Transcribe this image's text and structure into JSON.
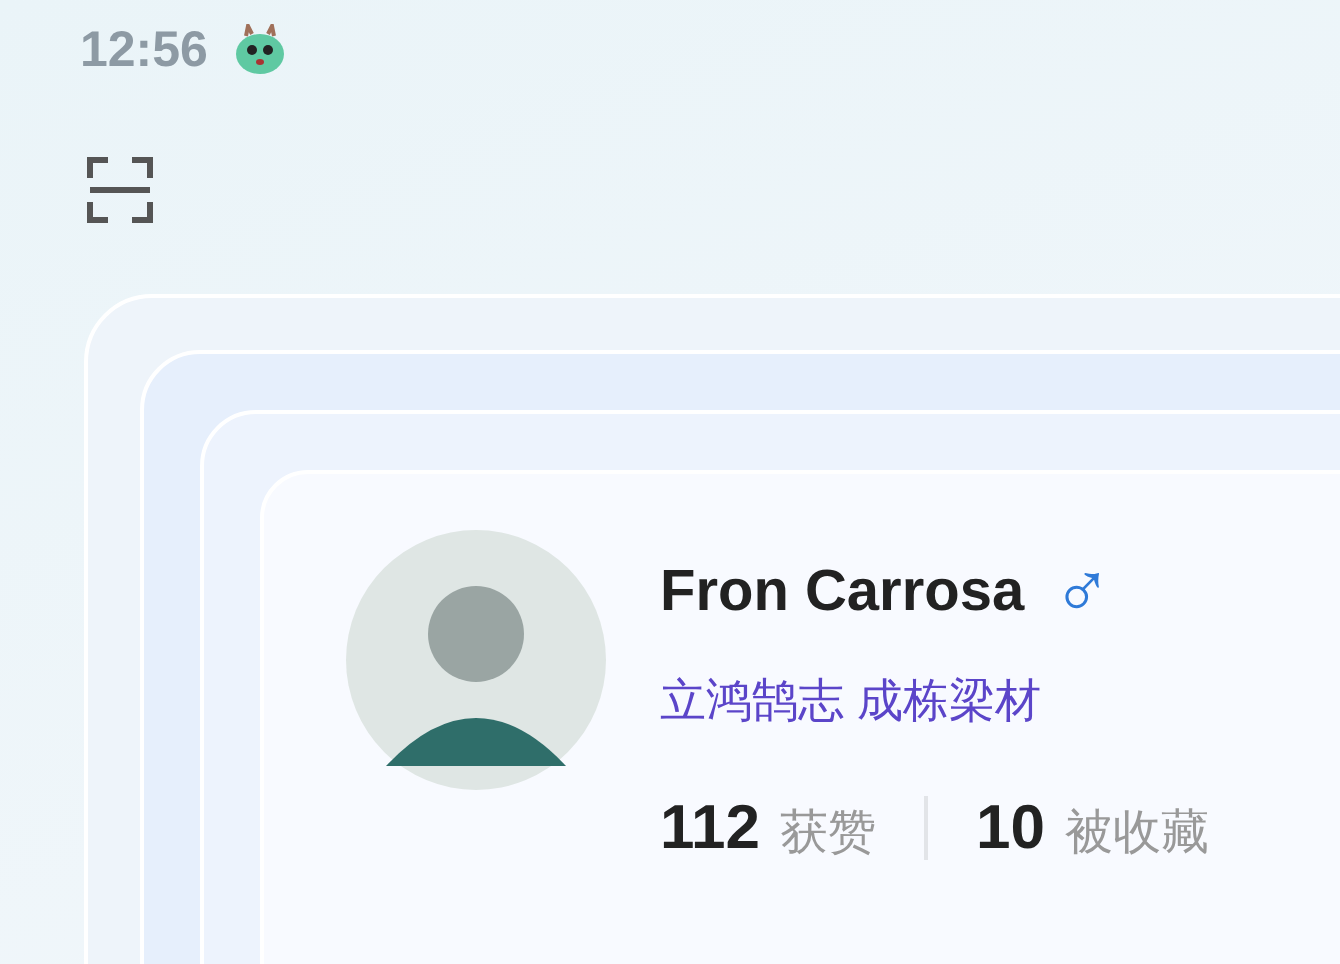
{
  "status_bar": {
    "time": "12:56"
  },
  "profile": {
    "name": "Fron Carrosa",
    "gender_symbol": "♂",
    "motto": "立鸿鹄志 成栋梁材",
    "stats": [
      {
        "value": "112",
        "label": "获赞"
      },
      {
        "value": "10",
        "label": "被收藏"
      }
    ]
  }
}
